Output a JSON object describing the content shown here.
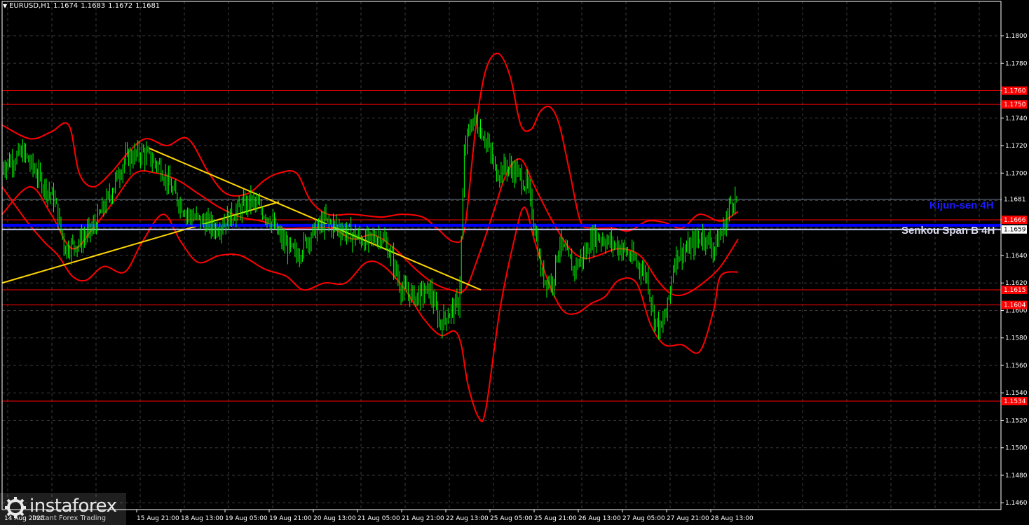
{
  "header": {
    "symbol": "EURUSD,H1",
    "open": "1.1674",
    "high": "1.1683",
    "low": "1.1672",
    "close": "1.1681"
  },
  "indicator_labels": {
    "kijun": "Kijun-sen 4H",
    "senkou": "Senkou Span B 4H"
  },
  "watermark": {
    "brand": "instaforex",
    "tagline": "Instant Forex Trading",
    "clipped_date": "14 Aug 2025"
  },
  "colors": {
    "background": "#000000",
    "grid": "#3c3c3c",
    "candles": "#00ff00",
    "bands": "#ff0000",
    "trendline": "#ffd700",
    "kijun": "#0000ff",
    "senkou": "#c8c8ff",
    "axis": "#ffffff"
  },
  "chart_data": {
    "type": "line",
    "ylim": [
      1.1455,
      1.1825
    ],
    "y_ticks": [
      "1.1800",
      "1.1780",
      "1.1760",
      "1.1740",
      "1.1720",
      "1.1700",
      "1.1681",
      "1.1666",
      "1.1640",
      "1.1620",
      "1.1600",
      "1.1580",
      "1.1560",
      "1.1540",
      "1.1520",
      "1.1500",
      "1.1480",
      "1.1460"
    ],
    "x_ticks": [
      "15 Aug 21:00",
      "18 Aug 13:00",
      "19 Aug 05:00",
      "19 Aug 21:00",
      "20 Aug 13:00",
      "21 Aug 05:00",
      "21 Aug 21:00",
      "22 Aug 13:00",
      "25 Aug 05:00",
      "25 Aug 21:00",
      "26 Aug 13:00",
      "27 Aug 05:00",
      "27 Aug 21:00",
      "28 Aug 13:00"
    ],
    "horizontal_levels": [
      {
        "value": 1.176,
        "label": "1.1760",
        "color": "#ff0000"
      },
      {
        "value": 1.175,
        "label": "1.1750",
        "color": "#ff0000"
      },
      {
        "value": 1.1666,
        "label": "1.1666",
        "color": "#ff0000"
      },
      {
        "value": 1.1615,
        "label": "1.1615",
        "color": "#ff0000"
      },
      {
        "value": 1.1604,
        "label": "1.1604",
        "color": "#ff0000"
      },
      {
        "value": 1.1534,
        "label": "1.1534",
        "color": "#ff0000"
      }
    ],
    "current_price": {
      "value": 1.1681,
      "label": "1.1681"
    },
    "kijun_level": {
      "value": 1.1662,
      "label": "1.1662"
    },
    "senkou_level": {
      "value": 1.1659,
      "label": "1.1659"
    },
    "price_path": [
      [
        0,
        1.1705
      ],
      [
        30,
        1.1715
      ],
      [
        55,
        1.1695
      ],
      [
        75,
        1.168
      ],
      [
        90,
        1.1645
      ],
      [
        110,
        1.165
      ],
      [
        130,
        1.166
      ],
      [
        150,
        1.168
      ],
      [
        175,
        1.171
      ],
      [
        200,
        1.1715
      ],
      [
        225,
        1.1705
      ],
      [
        245,
        1.1685
      ],
      [
        265,
        1.167
      ],
      [
        285,
        1.1665
      ],
      [
        305,
        1.166
      ],
      [
        330,
        1.167
      ],
      [
        355,
        1.168
      ],
      [
        380,
        1.1668
      ],
      [
        400,
        1.165
      ],
      [
        420,
        1.164
      ],
      [
        440,
        1.1655
      ],
      [
        460,
        1.1665
      ],
      [
        480,
        1.166
      ],
      [
        500,
        1.1655
      ],
      [
        520,
        1.165
      ],
      [
        540,
        1.1655
      ],
      [
        555,
        1.164
      ],
      [
        570,
        1.1615
      ],
      [
        590,
        1.161
      ],
      [
        610,
        1.1615
      ],
      [
        625,
        1.159
      ],
      [
        640,
        1.16
      ],
      [
        652,
        1.1605
      ],
      [
        660,
        1.172
      ],
      [
        672,
        1.174
      ],
      [
        690,
        1.1725
      ],
      [
        705,
        1.17
      ],
      [
        720,
        1.1705
      ],
      [
        735,
        1.17
      ],
      [
        750,
        1.169
      ],
      [
        760,
        1.166
      ],
      [
        770,
        1.1625
      ],
      [
        785,
        1.162
      ],
      [
        795,
        1.165
      ],
      [
        815,
        1.163
      ],
      [
        830,
        1.164
      ],
      [
        845,
        1.1655
      ],
      [
        865,
        1.165
      ],
      [
        885,
        1.1645
      ],
      [
        905,
        1.1635
      ],
      [
        920,
        1.1625
      ],
      [
        930,
        1.1595
      ],
      [
        940,
        1.1585
      ],
      [
        950,
        1.1605
      ],
      [
        960,
        1.164
      ],
      [
        980,
        1.1645
      ],
      [
        1000,
        1.1655
      ],
      [
        1015,
        1.1645
      ],
      [
        1030,
        1.166
      ],
      [
        1040,
        1.168
      ],
      [
        1050,
        1.1681
      ]
    ],
    "upper_band": [
      [
        0,
        1.1735
      ],
      [
        40,
        1.1725
      ],
      [
        70,
        1.173
      ],
      [
        95,
        1.1735
      ],
      [
        110,
        1.17
      ],
      [
        130,
        1.169
      ],
      [
        155,
        1.17
      ],
      [
        180,
        1.1715
      ],
      [
        205,
        1.1725
      ],
      [
        235,
        1.172
      ],
      [
        265,
        1.1725
      ],
      [
        295,
        1.17
      ],
      [
        320,
        1.1685
      ],
      [
        350,
        1.1685
      ],
      [
        375,
        1.1695
      ],
      [
        395,
        1.17
      ],
      [
        420,
        1.17
      ],
      [
        440,
        1.168
      ],
      [
        465,
        1.167
      ],
      [
        500,
        1.167
      ],
      [
        540,
        1.1668
      ],
      [
        570,
        1.167
      ],
      [
        600,
        1.1668
      ],
      [
        620,
        1.166
      ],
      [
        645,
        1.165
      ],
      [
        660,
        1.166
      ],
      [
        675,
        1.173
      ],
      [
        690,
        1.1775
      ],
      [
        708,
        1.1787
      ],
      [
        725,
        1.177
      ],
      [
        740,
        1.1735
      ],
      [
        755,
        1.1732
      ],
      [
        768,
        1.1745
      ],
      [
        782,
        1.1748
      ],
      [
        795,
        1.1735
      ],
      [
        810,
        1.17
      ],
      [
        825,
        1.1665
      ],
      [
        840,
        1.166
      ],
      [
        870,
        1.166
      ],
      [
        895,
        1.1658
      ],
      [
        920,
        1.1665
      ],
      [
        945,
        1.1664
      ],
      [
        970,
        1.166
      ],
      [
        995,
        1.167
      ],
      [
        1025,
        1.1665
      ],
      [
        1050,
        1.1672
      ]
    ],
    "middle_line": [
      [
        0,
        1.167
      ],
      [
        40,
        1.169
      ],
      [
        70,
        1.167
      ],
      [
        100,
        1.1645
      ],
      [
        130,
        1.166
      ],
      [
        160,
        1.168
      ],
      [
        190,
        1.17
      ],
      [
        220,
        1.17
      ],
      [
        250,
        1.1695
      ],
      [
        280,
        1.1685
      ],
      [
        310,
        1.1675
      ],
      [
        340,
        1.1668
      ],
      [
        370,
        1.1665
      ],
      [
        400,
        1.166
      ],
      [
        430,
        1.166
      ],
      [
        470,
        1.166
      ],
      [
        500,
        1.1652
      ],
      [
        530,
        1.1655
      ],
      [
        560,
        1.1645
      ],
      [
        590,
        1.163
      ],
      [
        615,
        1.162
      ],
      [
        640,
        1.1615
      ],
      [
        660,
        1.1615
      ],
      [
        680,
        1.164
      ],
      [
        700,
        1.167
      ],
      [
        720,
        1.17
      ],
      [
        740,
        1.171
      ],
      [
        760,
        1.169
      ],
      [
        785,
        1.1665
      ],
      [
        810,
        1.1645
      ],
      [
        830,
        1.1638
      ],
      [
        850,
        1.164
      ],
      [
        880,
        1.1645
      ],
      [
        910,
        1.164
      ],
      [
        935,
        1.1622
      ],
      [
        955,
        1.1612
      ],
      [
        975,
        1.1612
      ],
      [
        1000,
        1.162
      ],
      [
        1025,
        1.1632
      ],
      [
        1050,
        1.1652
      ]
    ],
    "lower_band": [
      [
        0,
        1.169
      ],
      [
        35,
        1.1665
      ],
      [
        60,
        1.165
      ],
      [
        80,
        1.164
      ],
      [
        100,
        1.1625
      ],
      [
        120,
        1.1622
      ],
      [
        145,
        1.1632
      ],
      [
        175,
        1.1628
      ],
      [
        200,
        1.165
      ],
      [
        230,
        1.167
      ],
      [
        255,
        1.165
      ],
      [
        280,
        1.1635
      ],
      [
        310,
        1.164
      ],
      [
        340,
        1.164
      ],
      [
        375,
        1.163
      ],
      [
        405,
        1.1625
      ],
      [
        430,
        1.1615
      ],
      [
        460,
        1.162
      ],
      [
        490,
        1.162
      ],
      [
        520,
        1.1635
      ],
      [
        545,
        1.1632
      ],
      [
        575,
        1.1615
      ],
      [
        600,
        1.1595
      ],
      [
        625,
        1.1582
      ],
      [
        645,
        1.1585
      ],
      [
        655,
        1.1575
      ],
      [
        665,
        1.1545
      ],
      [
        680,
        1.1522
      ],
      [
        690,
        1.1528
      ],
      [
        710,
        1.16
      ],
      [
        730,
        1.165
      ],
      [
        745,
        1.1675
      ],
      [
        760,
        1.165
      ],
      [
        780,
        1.162
      ],
      [
        800,
        1.16
      ],
      [
        820,
        1.1598
      ],
      [
        840,
        1.1605
      ],
      [
        860,
        1.161
      ],
      [
        880,
        1.1622
      ],
      [
        905,
        1.162
      ],
      [
        925,
        1.159
      ],
      [
        945,
        1.1575
      ],
      [
        970,
        1.1575
      ],
      [
        995,
        1.157
      ],
      [
        1015,
        1.16
      ],
      [
        1025,
        1.1625
      ],
      [
        1050,
        1.1628
      ]
    ],
    "trendlines": [
      {
        "from": [
          0,
          1.162
        ],
        "to": [
          395,
          1.1679
        ]
      },
      {
        "from": [
          210,
          1.1718
        ],
        "to": [
          683,
          1.1615
        ]
      }
    ]
  }
}
